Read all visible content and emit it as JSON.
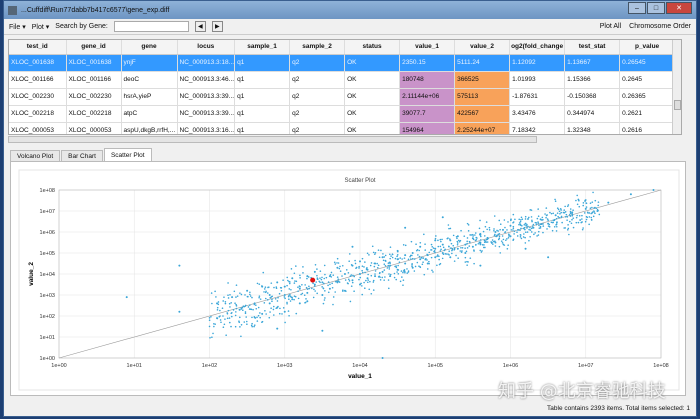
{
  "window": {
    "title": "...Cuffdiff\\Run77dabb7b417c6577\\gene_exp.diff"
  },
  "toolbar": {
    "file": "File ▾",
    "plot": "Plot ▾",
    "search_label": "Search by Gene:",
    "search_value": "",
    "plot_all": "Plot All",
    "chromosome_order": "Chromosome Order"
  },
  "table": {
    "columns": [
      "test_id",
      "gene_id",
      "gene",
      "locus",
      "sample_1",
      "sample_2",
      "status",
      "value_1",
      "value_2",
      "og2(fold_change",
      "test_stat",
      "p_value"
    ],
    "rows": [
      [
        "XLOC_001638",
        "XLOC_001638",
        "ynjF",
        "NC_000913.3:18...",
        "q1",
        "q2",
        "OK",
        "2350.15",
        "5111.24",
        "1.12092",
        "1.13667",
        "0.26545"
      ],
      [
        "XLOC_001166",
        "XLOC_001166",
        "deoC",
        "NC_000913.3:46...",
        "q1",
        "q2",
        "OK",
        "180748",
        "366525",
        "1.01993",
        "1.15366",
        "0.2645"
      ],
      [
        "XLOC_002230",
        "XLOC_002230",
        "hsrA,yieP",
        "NC_000913.3:39...",
        "q1",
        "q2",
        "OK",
        "2.11144e+06",
        "575113",
        "-1.87631",
        "-0.150368",
        "0.26365"
      ],
      [
        "XLOC_002218",
        "XLOC_002218",
        "atpC",
        "NC_000913.3:39...",
        "q1",
        "q2",
        "OK",
        "39077.7",
        "422567",
        "3.43476",
        "0.344974",
        "0.2621"
      ],
      [
        "XLOC_000053",
        "XLOC_000053",
        "aspU,dkgB,rrfH,...",
        "NC_000913.3:16...",
        "q1",
        "q2",
        "OK",
        "154964",
        "2.25244e+07",
        "7.18342",
        "1.32348",
        "0.2616"
      ]
    ]
  },
  "tabs": [
    "Volcano Plot",
    "Bar Chart",
    "Scatter Plot"
  ],
  "status": "Table contains 2393 items.  Total items selected: 1",
  "watermark": "知乎 @北京睿驰科技",
  "chart_data": {
    "type": "scatter",
    "title": "Scatter Plot",
    "xlabel": "value_1",
    "ylabel": "value_2",
    "xscale": "log10",
    "yscale": "log10",
    "xlim": [
      1,
      100000000
    ],
    "ylim": [
      1,
      100000000
    ],
    "xticks": [
      "1e+00",
      "1e+01",
      "1e+02",
      "1e+03",
      "1e+04",
      "1e+05",
      "1e+06",
      "1e+07",
      "1e+08"
    ],
    "yticks": [
      "1e+00",
      "1e+01",
      "1e+02",
      "1e+03",
      "1e+04",
      "1e+05",
      "1e+06",
      "1e+07",
      "1e+08"
    ],
    "grid": true,
    "reference_line": "y = x",
    "points_color": "#3aa6d8",
    "selected_color": "#e01010",
    "selected_point": [
      2350.15,
      5111.24
    ],
    "points_log10": [
      [
        1.6,
        4.4
      ],
      [
        0.9,
        2.9
      ],
      [
        1.6,
        2.2
      ],
      [
        2.1,
        1.9
      ],
      [
        2.1,
        2.6
      ],
      [
        2.3,
        2.9
      ],
      [
        2.4,
        2.3
      ],
      [
        2.5,
        3.2
      ],
      [
        2.6,
        2.6
      ],
      [
        2.7,
        3.4
      ],
      [
        2.7,
        2.1
      ],
      [
        2.8,
        3.0
      ],
      [
        2.8,
        2.6
      ],
      [
        2.9,
        3.6
      ],
      [
        2.9,
        2.4
      ],
      [
        3.0,
        3.0
      ],
      [
        3.0,
        3.4
      ],
      [
        3.0,
        2.2
      ],
      [
        3.1,
        3.8
      ],
      [
        3.1,
        2.8
      ],
      [
        3.2,
        3.3
      ],
      [
        3.2,
        2.6
      ],
      [
        3.3,
        3.9
      ],
      [
        3.3,
        3.1
      ],
      [
        3.3,
        2.7
      ],
      [
        3.4,
        3.5
      ],
      [
        3.4,
        4.1
      ],
      [
        3.5,
        3.0
      ],
      [
        3.5,
        3.6
      ],
      [
        3.6,
        3.9
      ],
      [
        3.6,
        3.3
      ],
      [
        3.7,
        4.3
      ],
      [
        3.7,
        3.6
      ],
      [
        3.8,
        3.2
      ],
      [
        3.8,
        4.0
      ],
      [
        3.9,
        4.4
      ],
      [
        3.9,
        3.7
      ],
      [
        4.0,
        4.0
      ],
      [
        4.0,
        3.5
      ],
      [
        4.0,
        4.6
      ],
      [
        4.1,
        4.2
      ],
      [
        4.1,
        3.8
      ],
      [
        4.2,
        4.5
      ],
      [
        4.2,
        3.9
      ],
      [
        4.3,
        4.8
      ],
      [
        4.3,
        4.1
      ],
      [
        4.4,
        4.4
      ],
      [
        4.4,
        3.9
      ],
      [
        4.5,
        4.7
      ],
      [
        4.5,
        4.2
      ],
      [
        4.5,
        5.1
      ],
      [
        4.6,
        4.5
      ],
      [
        4.6,
        4.9
      ],
      [
        4.7,
        4.3
      ],
      [
        4.7,
        5.0
      ],
      [
        4.8,
        4.7
      ],
      [
        4.8,
        5.3
      ],
      [
        4.9,
        4.9
      ],
      [
        4.9,
        4.5
      ],
      [
        5.0,
        5.2
      ],
      [
        5.0,
        4.8
      ],
      [
        5.0,
        5.6
      ],
      [
        5.1,
        5.0
      ],
      [
        5.1,
        5.4
      ],
      [
        5.2,
        4.8
      ],
      [
        5.2,
        5.6
      ],
      [
        5.3,
        5.2
      ],
      [
        5.3,
        5.8
      ],
      [
        5.4,
        5.4
      ],
      [
        5.4,
        5.0
      ],
      [
        5.5,
        5.7
      ],
      [
        5.5,
        5.3
      ],
      [
        5.6,
        5.9
      ],
      [
        5.6,
        5.5
      ],
      [
        5.7,
        5.7
      ],
      [
        5.8,
        6.0
      ],
      [
        5.8,
        5.5
      ],
      [
        5.9,
        6.1
      ],
      [
        6.0,
        5.8
      ],
      [
        6.0,
        6.3
      ],
      [
        6.1,
        6.1
      ],
      [
        6.2,
        6.4
      ],
      [
        6.3,
        6.2
      ],
      [
        6.4,
        6.6
      ],
      [
        6.5,
        6.4
      ],
      [
        6.6,
        6.8
      ],
      [
        6.8,
        6.9
      ],
      [
        7.0,
        7.1
      ],
      [
        7.3,
        7.4
      ],
      [
        7.6,
        7.8
      ],
      [
        7.9,
        8.0
      ],
      [
        4.3,
        0.0
      ],
      [
        6.5,
        4.8
      ],
      [
        3.5,
        1.3
      ],
      [
        2.9,
        1.4
      ],
      [
        5.1,
        6.7
      ],
      [
        4.6,
        6.2
      ],
      [
        3.9,
        5.3
      ],
      [
        5.6,
        4.4
      ],
      [
        6.2,
        5.2
      ]
    ]
  }
}
